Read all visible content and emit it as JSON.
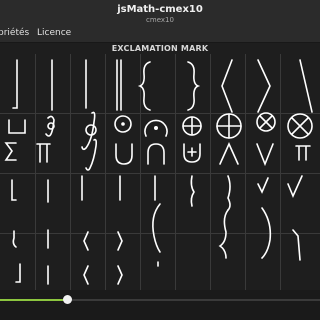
{
  "window": {
    "title": "jsMath-cmex10",
    "subtitle": "cmex10"
  },
  "menu": {
    "items": [
      "priétés",
      "Licence"
    ]
  },
  "glyph_name": "EXCLAMATION MARK",
  "zoom_slider": {
    "value": 0.21
  },
  "colors": {
    "accent": "#8cc63f",
    "background": "#1e1e1e",
    "glyph": "#ffffff"
  }
}
